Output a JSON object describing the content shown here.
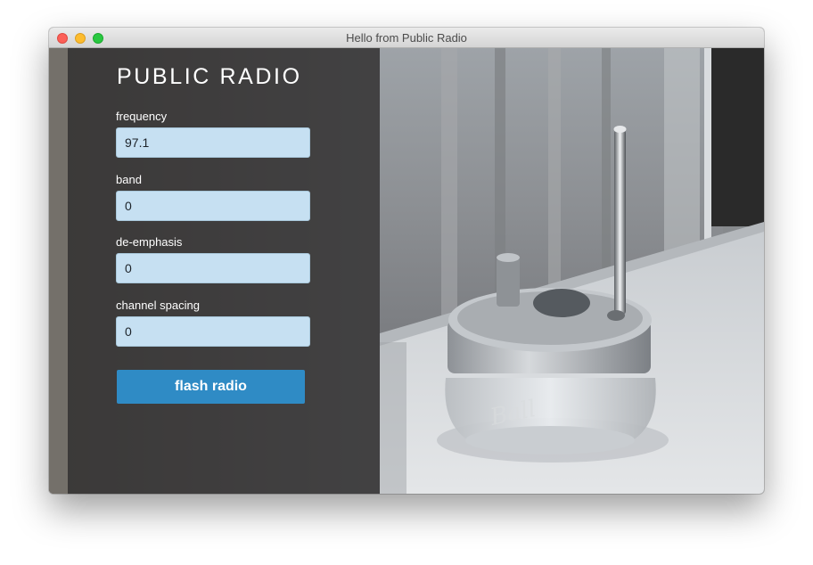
{
  "window": {
    "title": "Hello from Public Radio"
  },
  "app": {
    "brand": "PUBLIC RADIO"
  },
  "form": {
    "frequency": {
      "label": "frequency",
      "value": "97.1"
    },
    "band": {
      "label": "band",
      "value": "0"
    },
    "deemphasis": {
      "label": "de-emphasis",
      "value": "0"
    },
    "channel_spacing": {
      "label": "channel spacing",
      "value": "0"
    },
    "submit_label": "flash radio"
  },
  "colors": {
    "accent": "#2f8bc5",
    "field_bg": "#c6e0f2",
    "close": "#fc5f57",
    "minimize": "#fdbc2e",
    "maximize": "#29c840"
  },
  "icons": [
    "close-button",
    "minimize-button",
    "maximize-button"
  ]
}
